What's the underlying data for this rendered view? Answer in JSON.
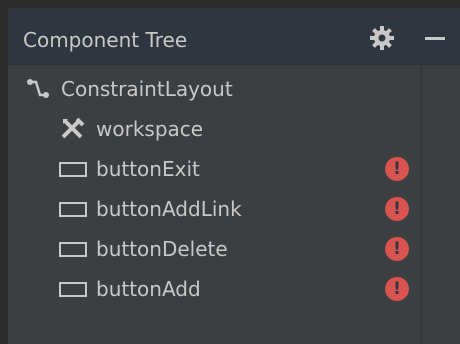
{
  "panel": {
    "title": "Component Tree",
    "settings_icon": "gear-icon",
    "minimize_icon": "minimize-icon"
  },
  "tree": {
    "root": {
      "label": "ConstraintLayout",
      "icon": "constraint-layout-icon"
    },
    "children": [
      {
        "label": "workspace",
        "icon": "tools-icon",
        "error": false
      },
      {
        "label": "buttonExit",
        "icon": "button-icon",
        "error": true
      },
      {
        "label": "buttonAddLink",
        "icon": "button-icon",
        "error": true
      },
      {
        "label": "buttonDelete",
        "icon": "button-icon",
        "error": true
      },
      {
        "label": "buttonAdd",
        "icon": "button-icon",
        "error": true
      }
    ]
  },
  "colors": {
    "panel_bg": "#3c3f41",
    "header_bg": "#2f3640",
    "text": "#c8c8c8",
    "error": "#d9534f"
  }
}
